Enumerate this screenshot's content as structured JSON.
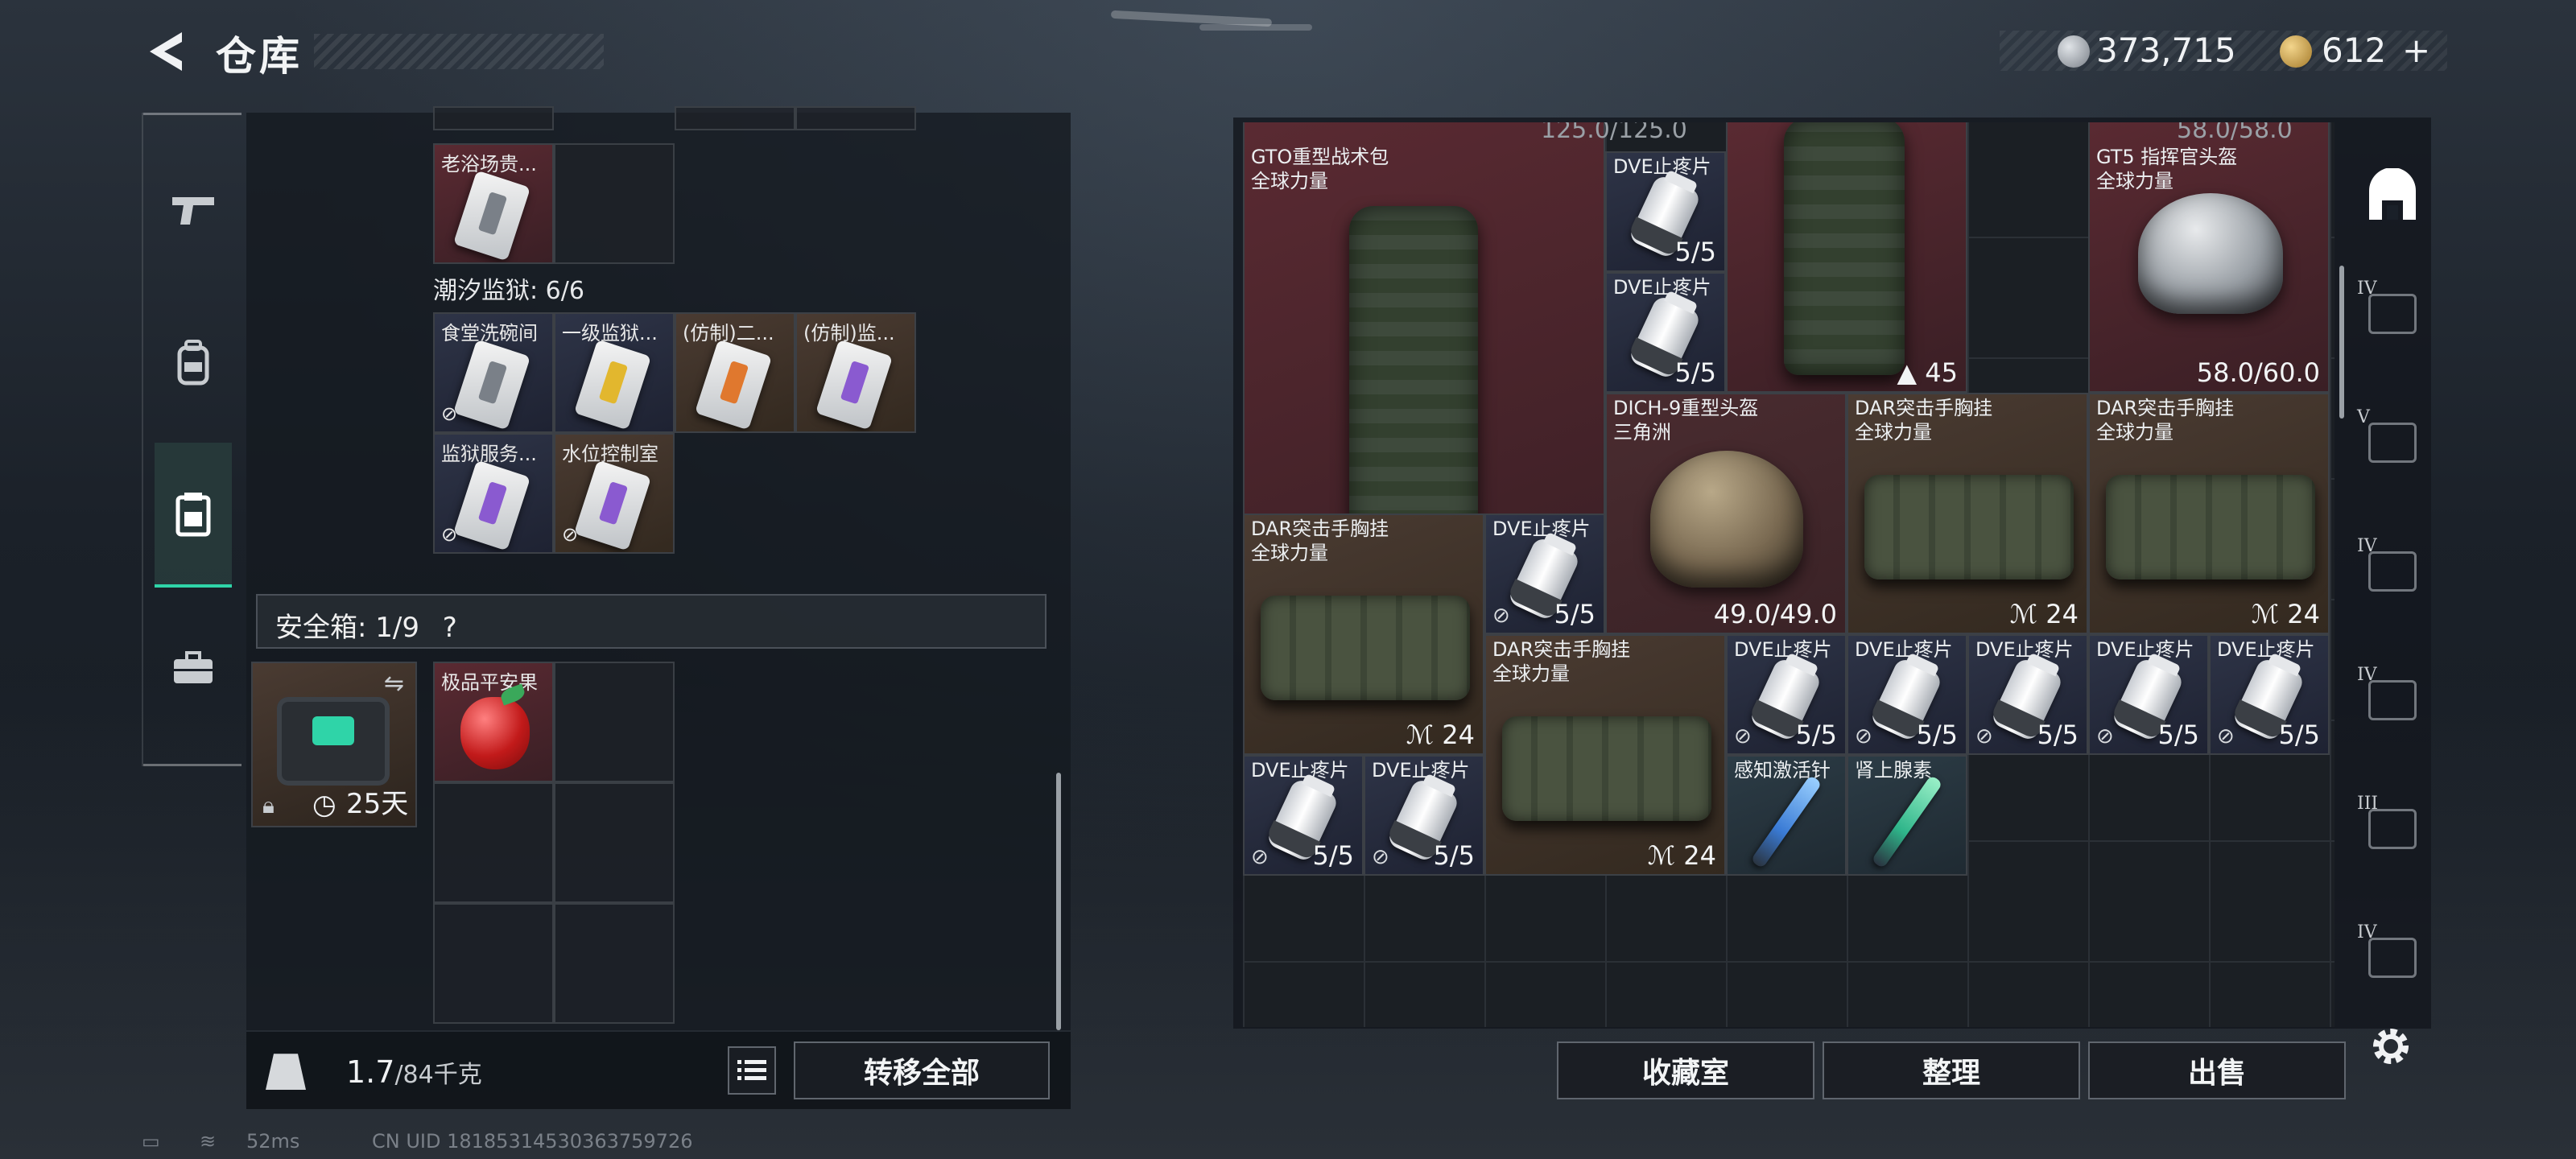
{
  "header": {
    "title": "仓库"
  },
  "currency": {
    "silver": "373,715",
    "gold": "612",
    "plus": "+"
  },
  "left": {
    "tab_icons": [
      "pistol-icon",
      "backpack-icon",
      "vest-icon",
      "briefcase-icon"
    ],
    "top_item": {
      "label": "老浴场贵..."
    },
    "section_prison": "潮汐监狱: 6/6",
    "keycards": [
      {
        "label": "食堂洗碗间",
        "color": "gray"
      },
      {
        "label": "一级监狱...",
        "color": "yellow"
      },
      {
        "label": "(仿制)二...",
        "color": "orange"
      },
      {
        "label": "(仿制)监...",
        "color": "purple"
      },
      {
        "label": "监狱服务...",
        "color": "purple"
      },
      {
        "label": "水位控制室",
        "color": "purple"
      }
    ],
    "safebox": {
      "label": "安全箱: 1/9",
      "help": "?",
      "timer": "25天"
    },
    "apple": {
      "label": "极品平安果"
    },
    "weight": {
      "value": "1.7",
      "max": "/84千克"
    },
    "transfer_all": "转移全部"
  },
  "stash": {
    "top_left_dur": "125.0/125.0",
    "top_right_dur": "58.0/58.0",
    "gto_bag": {
      "label": "GTO重型战术包\n全球力量",
      "count": "45"
    },
    "bag2": {
      "count": "45"
    },
    "gt5_helmet": {
      "label": "GT5 指挥官头盔\n全球力量",
      "dur": "58.0/60.0"
    },
    "dve": {
      "label": "DVE止疼片",
      "count": "5/5"
    },
    "dich": {
      "label": "DICH-9重型头盔\n三角洲",
      "dur": "49.0/49.0"
    },
    "dar": {
      "label": "DAR突击手胸挂\n全球力量",
      "count": "24"
    },
    "stim1": {
      "label": "感知激活针"
    },
    "stim2": {
      "label": "肾上腺素"
    },
    "buttons": {
      "collection": "收藏室",
      "sort": "整理",
      "sell": "出售"
    }
  },
  "right_tabs": [
    "IV",
    "V",
    "IV",
    "IV",
    "III",
    "IV"
  ],
  "status": {
    "ping": "52ms",
    "uid": "CN UID 18185314530363759726"
  },
  "colors": {
    "accent": "#2fd4a8",
    "red_tier": "#5a2a32",
    "navy_tier": "#2e3447",
    "brown_tier": "#4a3b32"
  }
}
